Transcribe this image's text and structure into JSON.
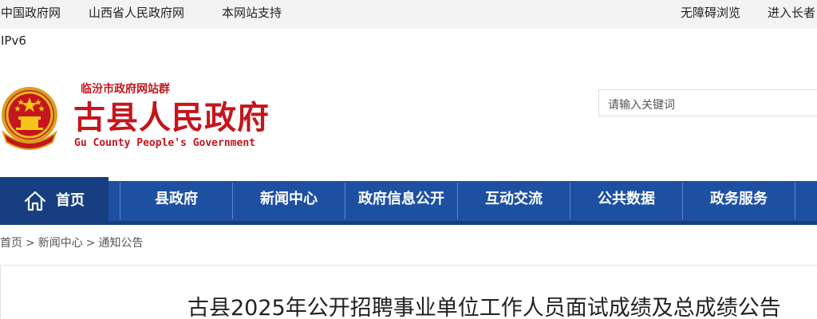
{
  "topbar": {
    "links": [
      "中国政府网",
      "山西省人民政府网",
      "本网站支持"
    ],
    "ipv6": "IPv6",
    "accessibility": "无障碍浏览",
    "elder_mode": "进入长者"
  },
  "header": {
    "site_group": "临汾市政府网站群",
    "title": "古县人民政府",
    "subtitle": "Gu County People's Government"
  },
  "search": {
    "placeholder": "请输入关键词"
  },
  "nav": {
    "home": "首页",
    "items": [
      "县政府",
      "新闻中心",
      "政府信息公开",
      "互动交流",
      "公共数据",
      "政务服务"
    ]
  },
  "breadcrumb": {
    "items": [
      "首页",
      "新闻中心",
      "通知公告"
    ],
    "separator": ">"
  },
  "article": {
    "title": "古县2025年公开招聘事业单位工作人员面试成绩及总成绩公告"
  },
  "colors": {
    "brand_red": "#c4161c",
    "nav_blue": "#1e50a2",
    "nav_home_blue": "#173e80",
    "topbar_bg": "#f3f3f3"
  }
}
